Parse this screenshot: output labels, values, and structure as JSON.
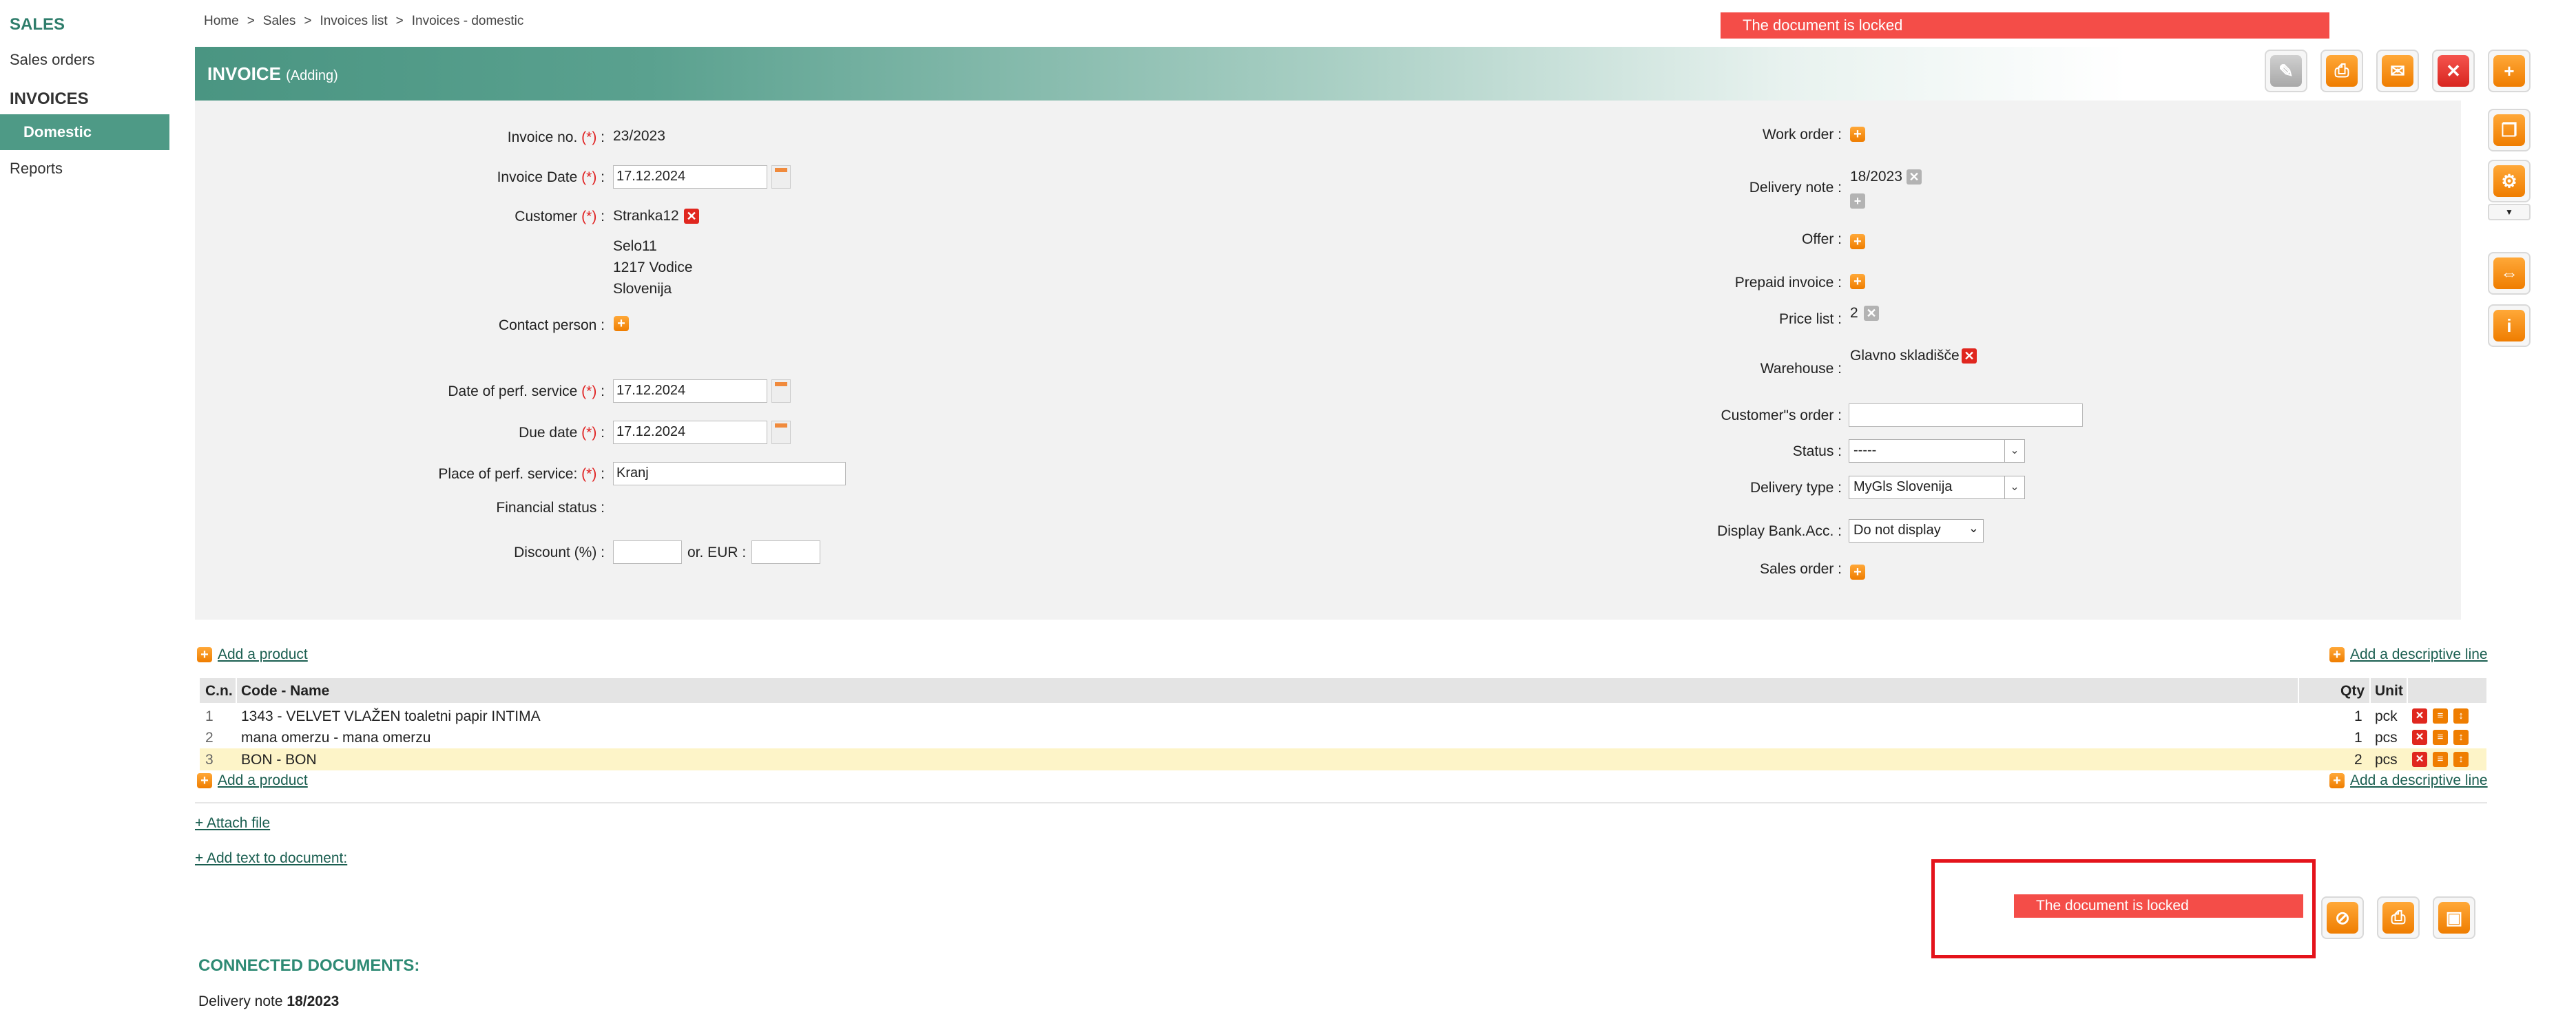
{
  "sidebar": {
    "sales_heading": "SALES",
    "sales_orders": "Sales orders",
    "invoices_heading": "INVOICES",
    "domestic": "Domestic",
    "reports": "Reports"
  },
  "breadcrumb": [
    "Home",
    "Sales",
    "Invoices list",
    "Invoices - domestic"
  ],
  "locked_message": "The document is locked",
  "header": {
    "title": "INVOICE",
    "mode": "(Adding)"
  },
  "form_left": {
    "invoice_no_label": "Invoice no.",
    "invoice_no": "23/2023",
    "invoice_date_label": "Invoice Date",
    "invoice_date": "17.12.2024",
    "customer_label": "Customer",
    "customer": "Stranka12",
    "address_line1": "Selo11",
    "address_line2": "1217 Vodice",
    "address_line3": "Slovenija",
    "contact_person_label": "Contact person :",
    "perf_date_label": "Date of perf. service",
    "perf_date": "17.12.2024",
    "due_date_label": "Due date",
    "due_date": "17.12.2024",
    "place_label": "Place of perf. service:",
    "place": "Kranj",
    "financial_status_label": "Financial status :",
    "discount_label": "Discount (%) :",
    "or_eur_label": "or. EUR :",
    "required_mark": "(*)",
    "colon": " :"
  },
  "form_right": {
    "work_order_label": "Work order :",
    "delivery_note_label": "Delivery note :",
    "delivery_note": "18/2023",
    "offer_label": "Offer :",
    "prepaid_invoice_label": "Prepaid invoice :",
    "price_list_label": "Price list :",
    "price_list": "2",
    "warehouse_label": "Warehouse :",
    "warehouse": "Glavno skladišče",
    "customers_order_label": "Customer\"s order :",
    "status_label": "Status :",
    "status": "-----",
    "delivery_type_label": "Delivery type :",
    "delivery_type": "MyGls Slovenija",
    "bank_acc_label": "Display Bank.Acc. :",
    "bank_acc": "Do not display",
    "sales_order_label": "Sales order :"
  },
  "links": {
    "add_product": "Add a product",
    "add_descriptive_line": "Add a descriptive line",
    "attach_file": "+ Attach file",
    "add_text": "+ Add text to document:"
  },
  "table": {
    "headers": [
      "C.n.",
      "Code - Name",
      "Qty",
      "Unit"
    ],
    "rows": [
      {
        "n": "1",
        "name": "1343 - VELVET VLAŽEN toaletni papir INTIMA",
        "qty": "1",
        "unit": "pck"
      },
      {
        "n": "2",
        "name": "mana omerzu - mana omerzu",
        "qty": "1",
        "unit": "pcs"
      },
      {
        "n": "3",
        "name": "BON - BON",
        "qty": "2",
        "unit": "pcs"
      }
    ]
  },
  "connected": {
    "heading": "CONNECTED DOCUMENTS:",
    "delivery_prefix": "Delivery note",
    "delivery_number": "18/2023"
  },
  "colors": {
    "accent": "#4e9a86",
    "locked": "#f44d48",
    "orange": "#ef7d00",
    "red": "#e0271f"
  }
}
